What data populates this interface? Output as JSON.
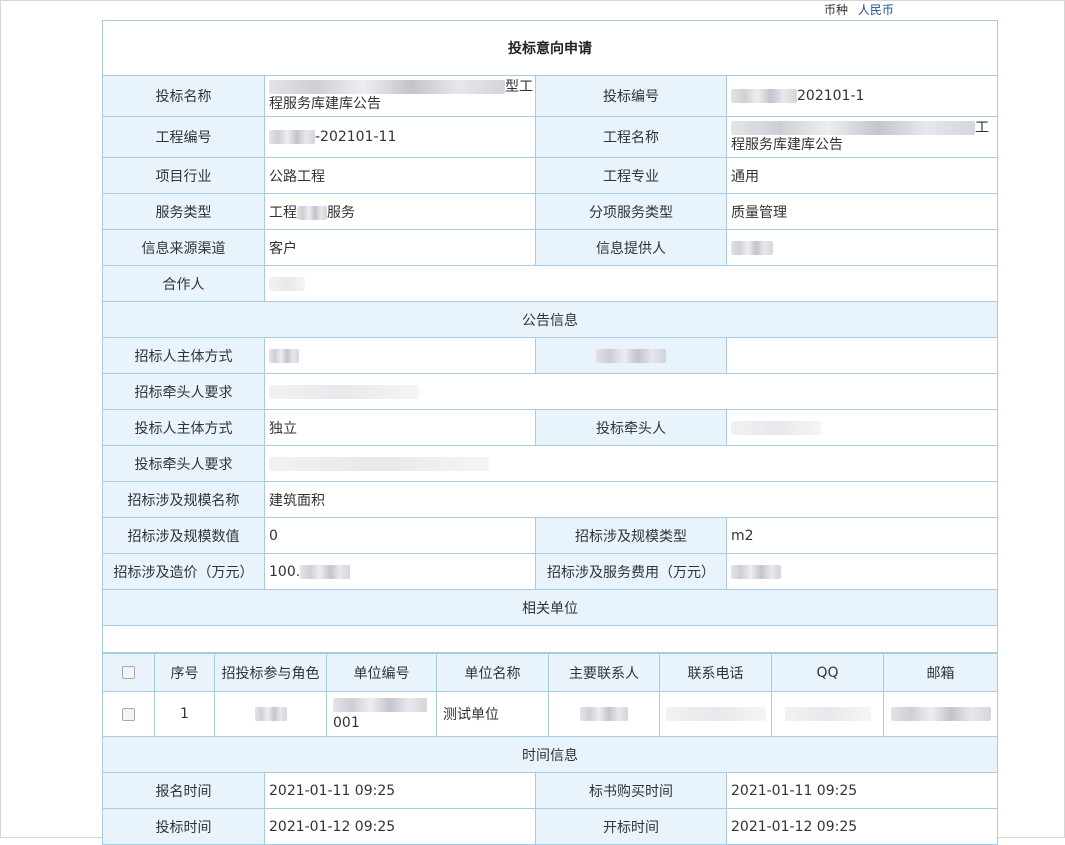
{
  "currency": {
    "label": "币种",
    "value": "人民币"
  },
  "title": "投标意向申请",
  "fields": {
    "bid_name": {
      "label": "投标名称",
      "value_tail": "型工",
      "value_line2": "程服务库建库公告"
    },
    "bid_no": {
      "label": "投标编号",
      "value": "202101-1"
    },
    "project_no": {
      "label": "工程编号",
      "value": "-202101-11"
    },
    "project_name": {
      "label": "工程名称",
      "value_tail": "工",
      "value_line2": "程服务库建库公告"
    },
    "industry": {
      "label": "项目行业",
      "value": "公路工程"
    },
    "specialty": {
      "label": "工程专业",
      "value": "通用"
    },
    "service_type": {
      "label": "服务类型",
      "value_a": "工程",
      "value_b": "服务"
    },
    "sub_service_type": {
      "label": "分项服务类型",
      "value": "质量管理"
    },
    "info_source": {
      "label": "信息来源渠道",
      "value": "客户"
    },
    "info_provider": {
      "label": "信息提供人"
    },
    "partner": {
      "label": "合作人"
    }
  },
  "sections": {
    "notice": "公告信息",
    "units": "相关单位",
    "time": "时间信息"
  },
  "notice": {
    "tenderer_mode": {
      "label": "招标人主体方式"
    },
    "tender_lead_req": {
      "label": "招标牵头人要求"
    },
    "bidder_mode": {
      "label": "投标人主体方式",
      "value": "独立"
    },
    "bid_lead": {
      "label": "投标牵头人"
    },
    "bid_lead_req": {
      "label": "投标牵头人要求"
    },
    "scale_name": {
      "label": "招标涉及规模名称",
      "value": "建筑面积"
    },
    "scale_value": {
      "label": "招标涉及规模数值",
      "value": "0"
    },
    "scale_type": {
      "label": "招标涉及规模类型",
      "value": "m2"
    },
    "cost": {
      "label": "招标涉及造价（万元）",
      "value": "100."
    },
    "service_fee": {
      "label": "招标涉及服务费用（万元）"
    }
  },
  "units_table": {
    "headers": [
      "序号",
      "招投标参与角色",
      "单位编号",
      "单位名称",
      "主要联系人",
      "联系电话",
      "QQ",
      "邮箱"
    ],
    "rows": [
      {
        "index": "1",
        "unit_no_tail": "001",
        "unit_name": "测试单位"
      }
    ]
  },
  "time": {
    "signup": {
      "label": "报名时间",
      "value": "2021-01-11 09:25"
    },
    "doc_buy": {
      "label": "标书购买时间",
      "value": "2021-01-11 09:25"
    },
    "bid_time": {
      "label": "投标时间",
      "value": "2021-01-12 09:25"
    },
    "open_time": {
      "label": "开标时间",
      "value": "2021-01-12 09:25"
    }
  }
}
